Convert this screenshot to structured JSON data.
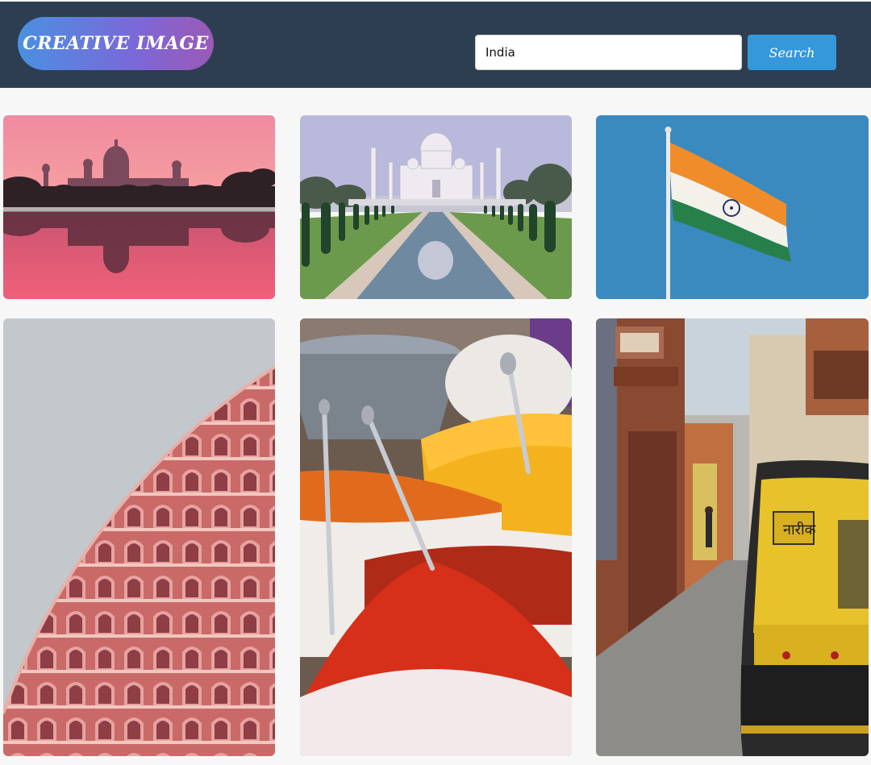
{
  "header": {
    "logo_text": "CREATIVE IMAGE"
  },
  "search": {
    "value": "India",
    "button_label": "Search"
  },
  "gallery": {
    "images": [
      {
        "subject": "Victoria Memorial at sunset with reflection"
      },
      {
        "subject": "Taj Mahal with reflecting pool"
      },
      {
        "subject": "Indian national flag"
      },
      {
        "subject": "Hawa Mahal pink facade"
      },
      {
        "subject": "Spice market powders"
      },
      {
        "subject": "Street with yellow auto rickshaw"
      }
    ],
    "auto_rickshaw_sign": "नारीक"
  },
  "colors": {
    "header_bg": "#2c3e50",
    "accent": "#3498db",
    "logo_gradient_start": "#4a90e2",
    "logo_gradient_end": "#9b59b6"
  }
}
